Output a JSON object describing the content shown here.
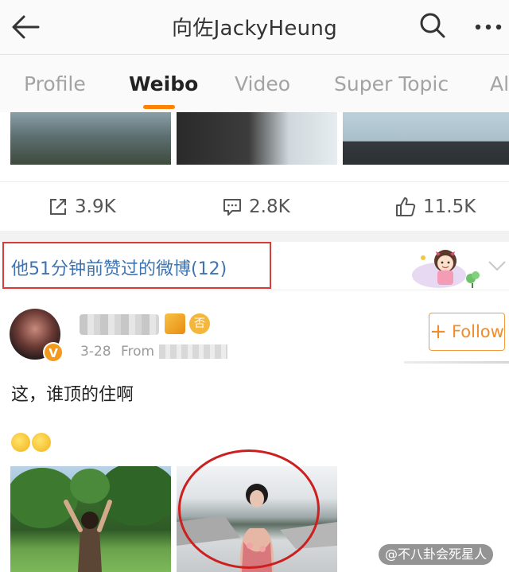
{
  "header": {
    "title": "向佐JackyHeung",
    "back_icon": "arrow-left-icon",
    "search_icon": "search-icon",
    "more_icon": "more-dots-icon"
  },
  "tabs": [
    {
      "label": "Profile",
      "active": false
    },
    {
      "label": "Weibo",
      "active": true
    },
    {
      "label": "Video",
      "active": false
    },
    {
      "label": "Super Topic",
      "active": false
    },
    {
      "label": "Al",
      "active": false
    }
  ],
  "accent_color": "#ff8200",
  "actions": {
    "repost": "3.9K",
    "comments": "2.8K",
    "likes": "11.5K"
  },
  "liked_banner": {
    "text": "他51分钟前赞过的微博(12)"
  },
  "post": {
    "date": "3-28",
    "from_label": "From",
    "verified_badge": "V",
    "badge2_text": "否",
    "follow_label": "Follow",
    "text": "这，谁顶的住啊"
  },
  "watermark": {
    "text": "@不八卦会死星人"
  }
}
